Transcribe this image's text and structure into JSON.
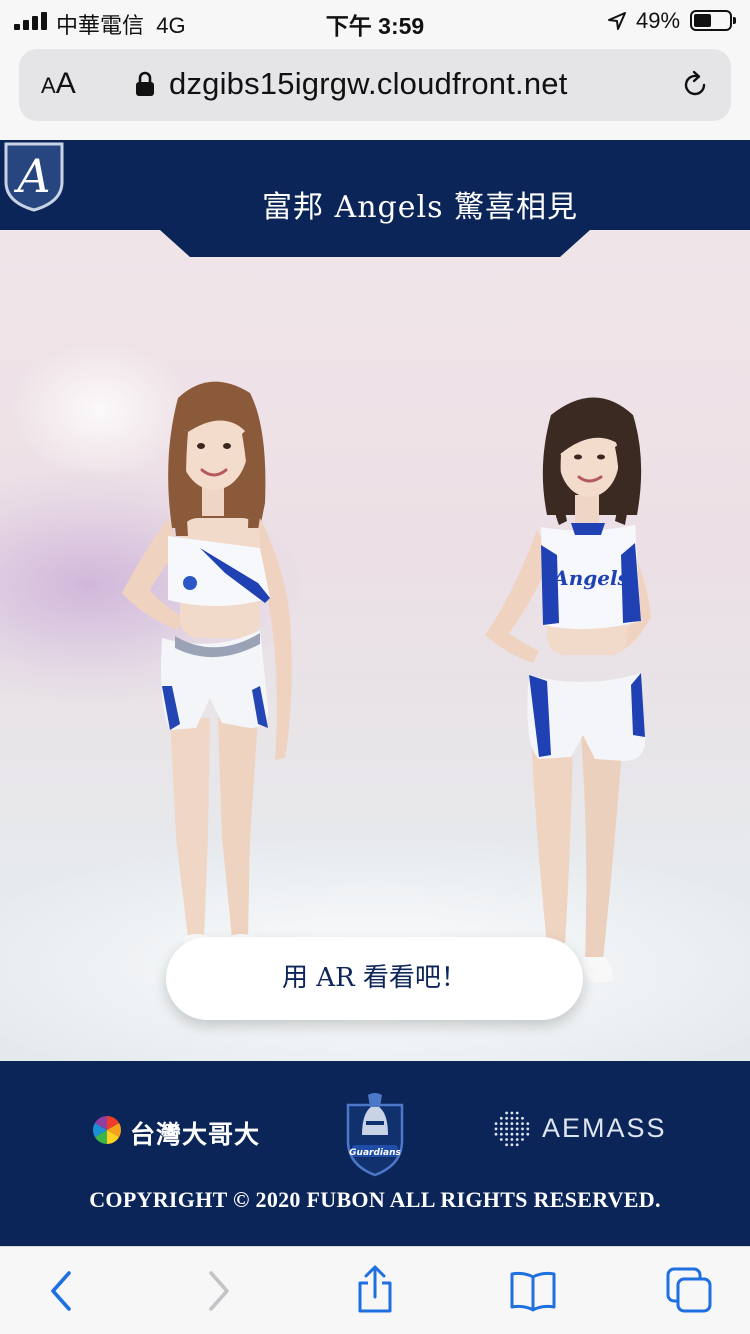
{
  "status_bar": {
    "carrier": "中華電信",
    "network": "4G",
    "time": "下午 3:59",
    "battery_percent": "49%",
    "battery_level": 0.49
  },
  "browser": {
    "text_size_label": "AA",
    "url": "dzgibs15igrgw.cloudfront.net"
  },
  "header": {
    "title": "富邦 Angels 驚喜相見",
    "logo_icon": "angels-shield-logo"
  },
  "hero": {
    "ar_button_label": "用 AR 看看吧！"
  },
  "footer": {
    "sponsors": [
      {
        "name": "台灣大哥大",
        "icon": "taiwan-mobile-logo"
      },
      {
        "name": "Guardians",
        "icon": "guardians-knight-logo"
      },
      {
        "name": "AEMASS",
        "icon": "aemass-logo"
      }
    ],
    "copyright": "COPYRIGHT © 2020 FUBON ALL RIGHTS RESERVED."
  },
  "toolbar": {
    "buttons": [
      "back",
      "forward",
      "share",
      "bookmarks",
      "tabs"
    ]
  },
  "colors": {
    "brand_navy": "#0b2559",
    "hero_background": "#ece2e7",
    "button_text": "#0d2559"
  }
}
